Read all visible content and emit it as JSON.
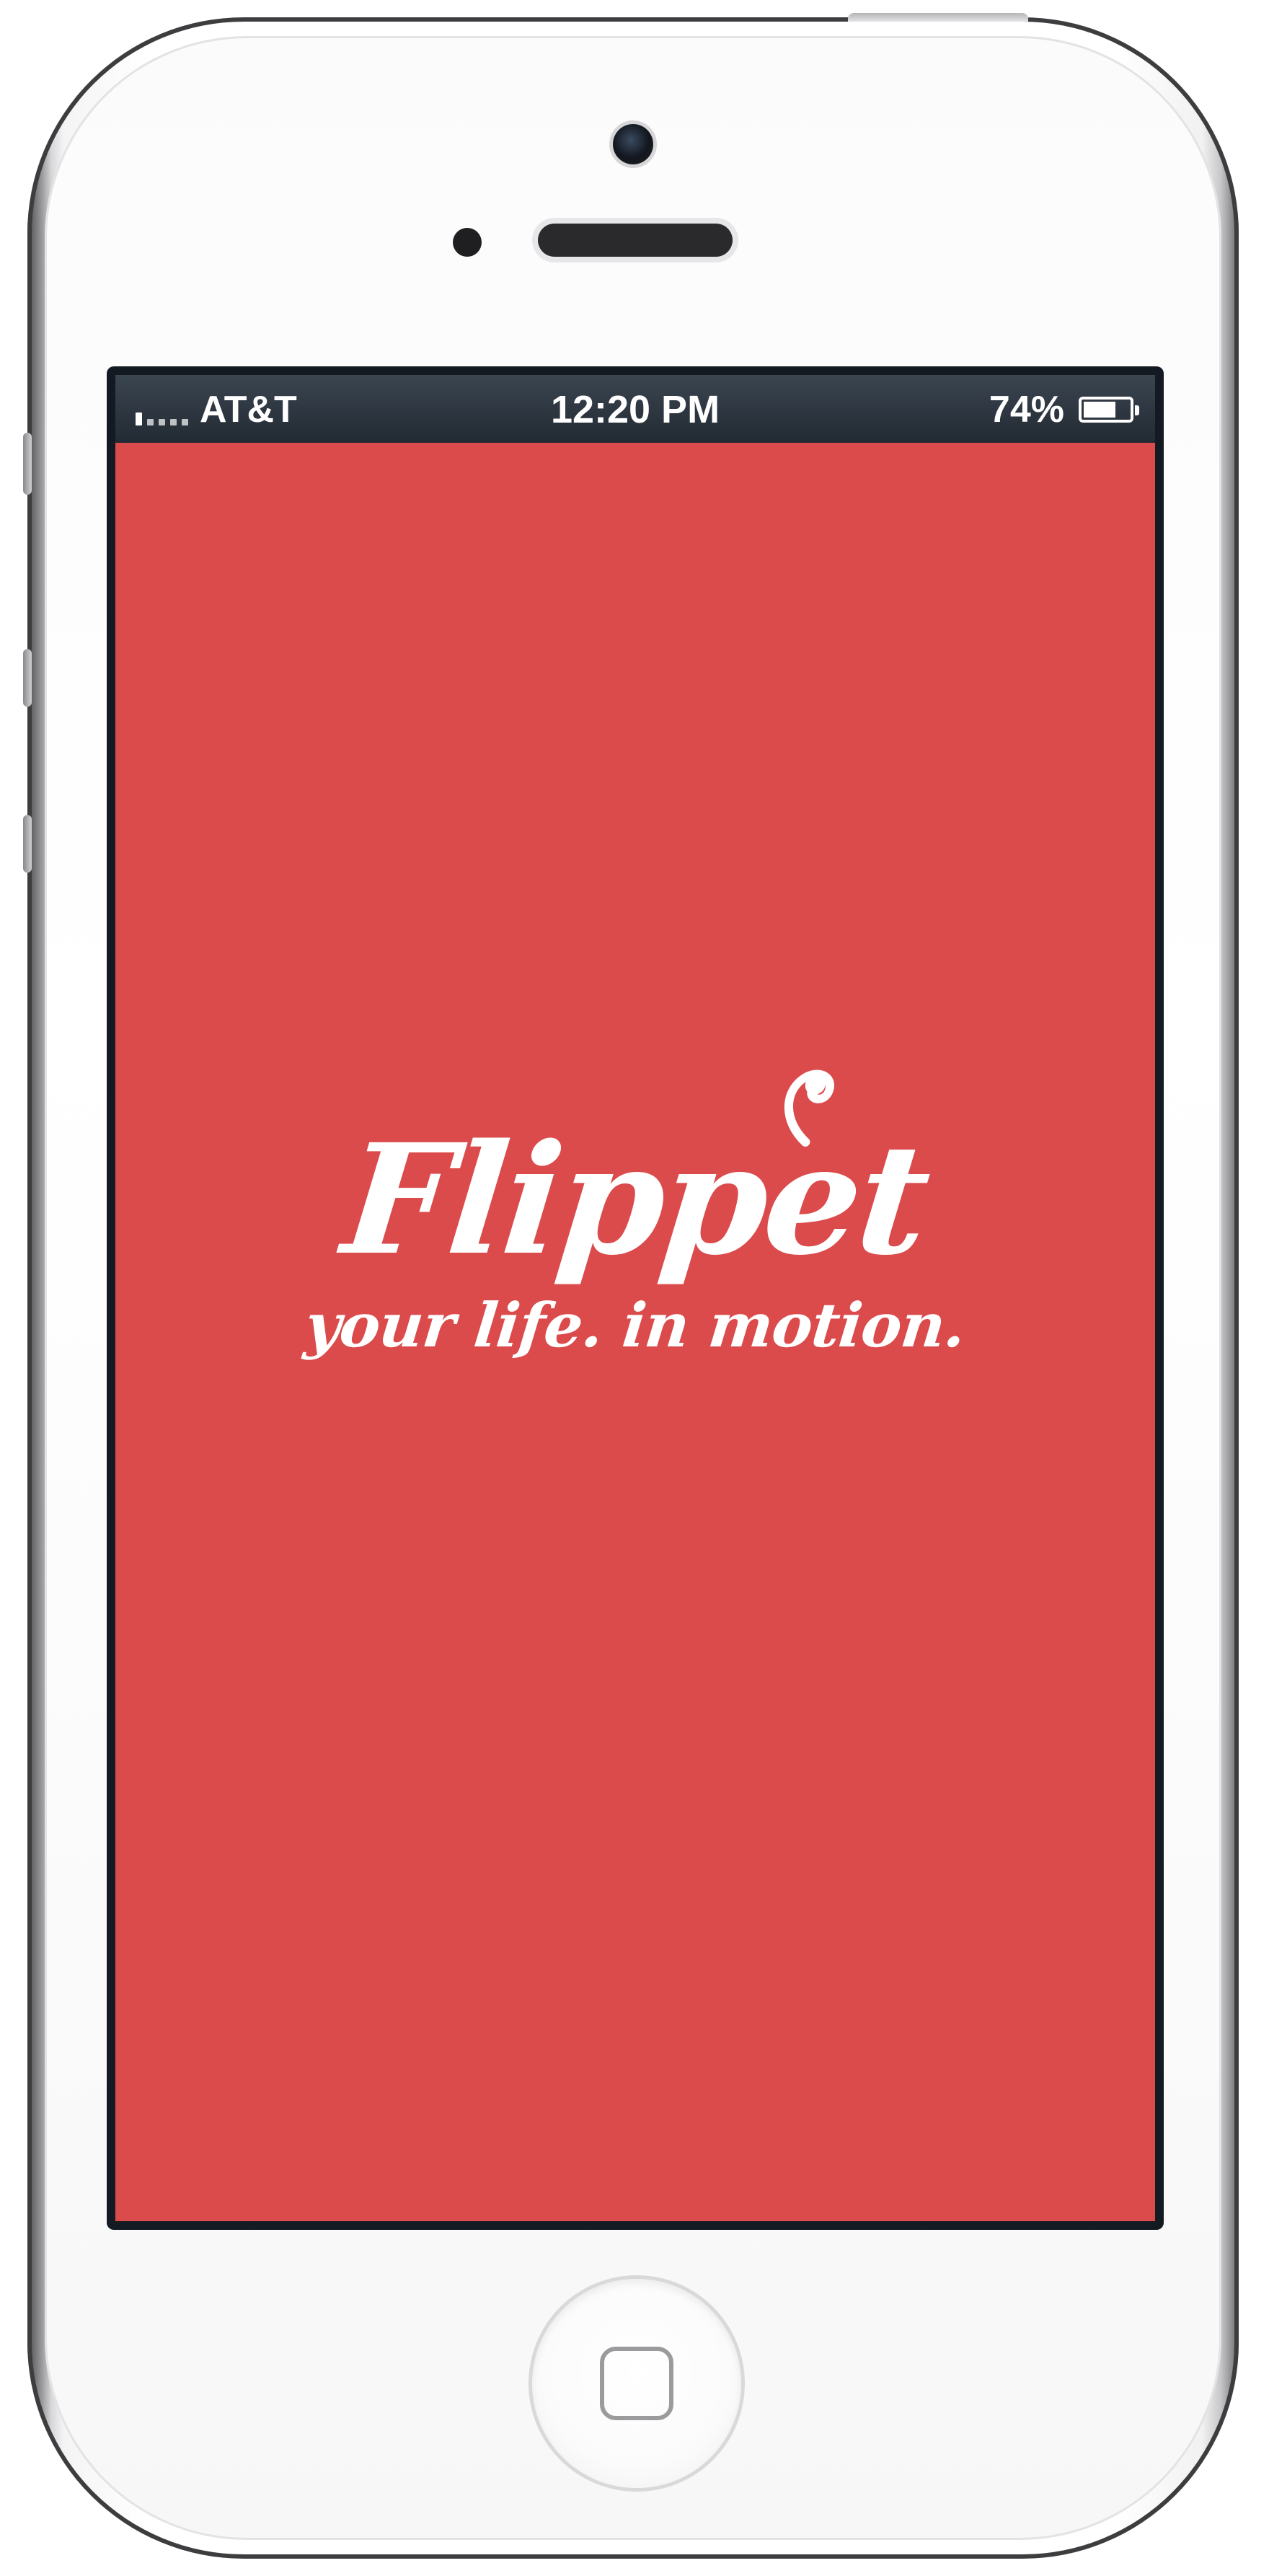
{
  "status_bar": {
    "carrier": "AT&T",
    "time": "12:20 PM",
    "battery_percent": "74%",
    "battery_level": 0.74,
    "signal_bars_on": 1,
    "signal_bars_total": 5
  },
  "app": {
    "name": "Flippet",
    "tagline": "your life. in motion.",
    "background_color": "#dc4b4c",
    "text_color": "#ffffff"
  },
  "icons": {
    "signal": "signal-strength-icon",
    "battery": "battery-icon",
    "home": "home-button-square-icon"
  }
}
